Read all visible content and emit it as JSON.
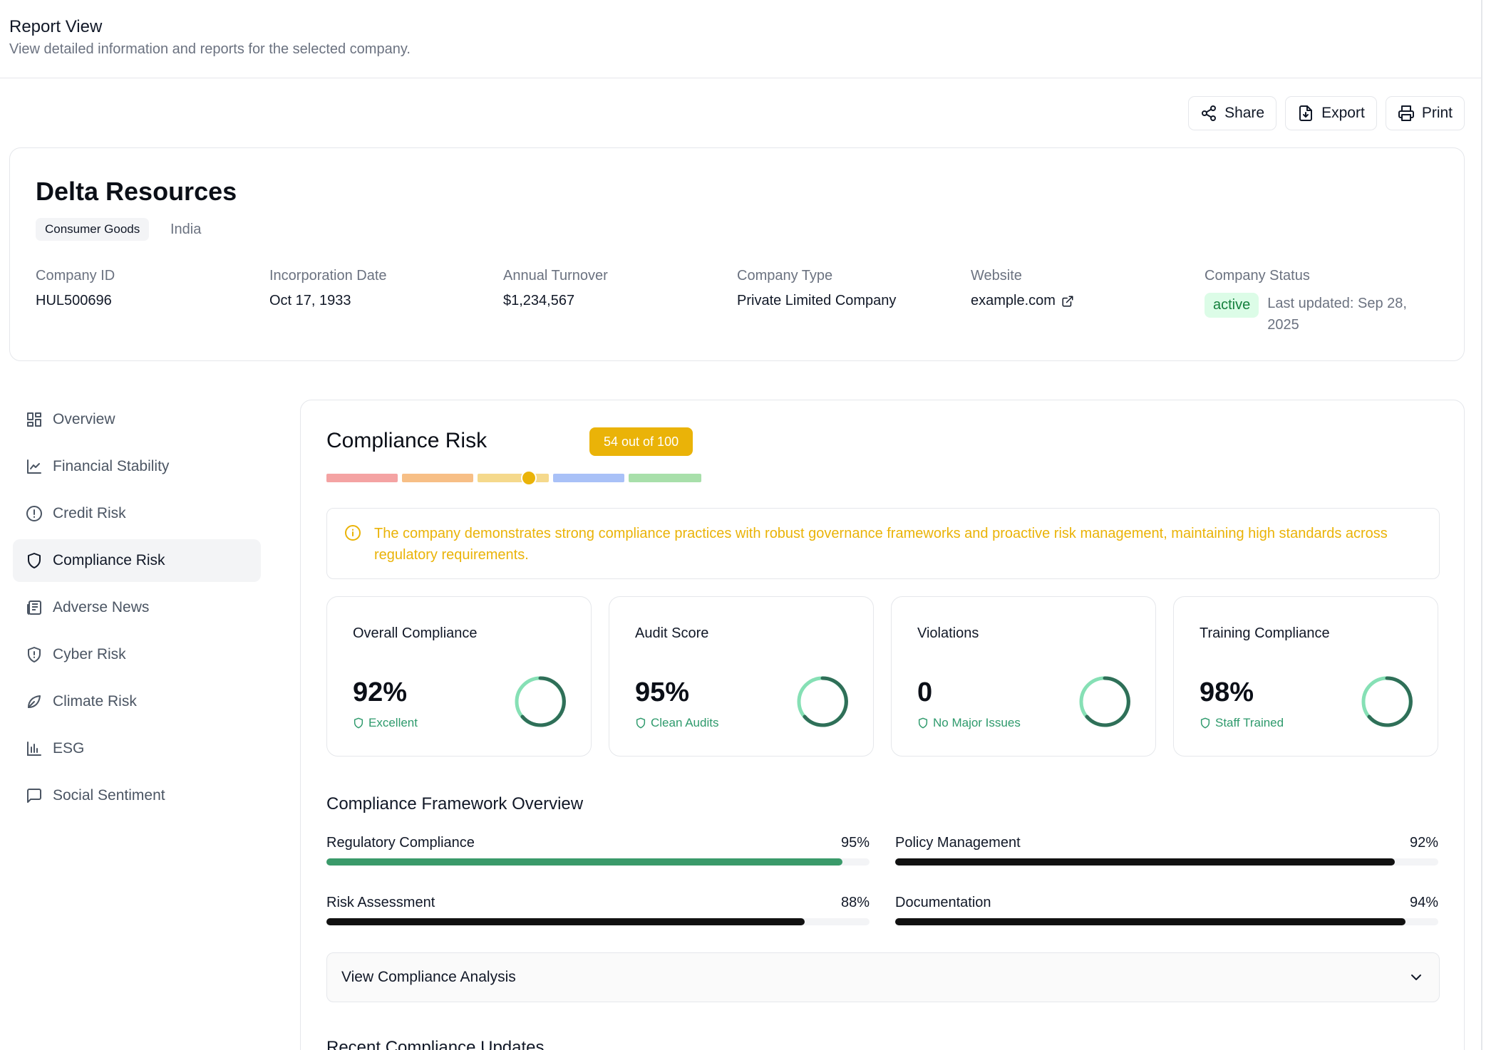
{
  "header": {
    "title": "Report View",
    "subtitle": "View detailed information and reports for the selected company."
  },
  "actions": {
    "share": "Share",
    "export": "Export",
    "print": "Print"
  },
  "company": {
    "name": "Delta Resources",
    "sector": "Consumer Goods",
    "country": "India",
    "fields": [
      {
        "label": "Company ID",
        "value": "HUL500696"
      },
      {
        "label": "Incorporation Date",
        "value": "Oct 17, 1933"
      },
      {
        "label": "Annual Turnover",
        "value": "$1,234,567"
      },
      {
        "label": "Company Type",
        "value": "Private Limited Company"
      },
      {
        "label": "Website",
        "value": "example.com"
      },
      {
        "label": "Company Status",
        "value": "active"
      }
    ],
    "last_updated": "Last updated: Sep 28, 2025"
  },
  "sidebar": {
    "items": [
      {
        "label": "Overview",
        "icon": "grid-icon"
      },
      {
        "label": "Financial Stability",
        "icon": "line-chart-icon"
      },
      {
        "label": "Credit Risk",
        "icon": "alert-circle-icon"
      },
      {
        "label": "Compliance Risk",
        "icon": "shield-icon",
        "active": true
      },
      {
        "label": "Adverse News",
        "icon": "newspaper-icon"
      },
      {
        "label": "Cyber Risk",
        "icon": "shield-alert-icon"
      },
      {
        "label": "Climate Risk",
        "icon": "leaf-icon"
      },
      {
        "label": "ESG",
        "icon": "bar-chart-icon"
      },
      {
        "label": "Social Sentiment",
        "icon": "message-square-icon"
      }
    ]
  },
  "compliance": {
    "title": "Compliance Risk",
    "score_label": "54 out of 100",
    "score": 54,
    "score_max": 100,
    "scale_colors": [
      "#f4a3a3",
      "#f7bf86",
      "#f5d98c",
      "#a9c1f7",
      "#a8dfaa"
    ],
    "accent": "#eab308",
    "alert_icon": "info-icon",
    "alert": "The company demonstrates strong compliance practices with robust governance frameworks and proactive risk management, maintaining high standards across regulatory requirements.",
    "metrics": [
      {
        "label": "Overall Compliance",
        "value": "92%",
        "sub": "Excellent"
      },
      {
        "label": "Audit Score",
        "value": "95%",
        "sub": "Clean Audits"
      },
      {
        "label": "Violations",
        "value": "0",
        "sub": "No Major Issues"
      },
      {
        "label": "Training Compliance",
        "value": "98%",
        "sub": "Staff Trained"
      }
    ],
    "framework_title": "Compliance Framework Overview",
    "framework": [
      {
        "label": "Regulatory Compliance",
        "pct": "95%",
        "value": 95,
        "color": "#3a9a6a"
      },
      {
        "label": "Policy Management",
        "pct": "92%",
        "value": 92,
        "color": "#111111"
      },
      {
        "label": "Risk Assessment",
        "pct": "88%",
        "value": 88,
        "color": "#111111"
      },
      {
        "label": "Documentation",
        "pct": "94%",
        "value": 94,
        "color": "#111111"
      }
    ],
    "accordion_label": "View Compliance Analysis",
    "updates_title": "Recent Compliance Updates"
  }
}
